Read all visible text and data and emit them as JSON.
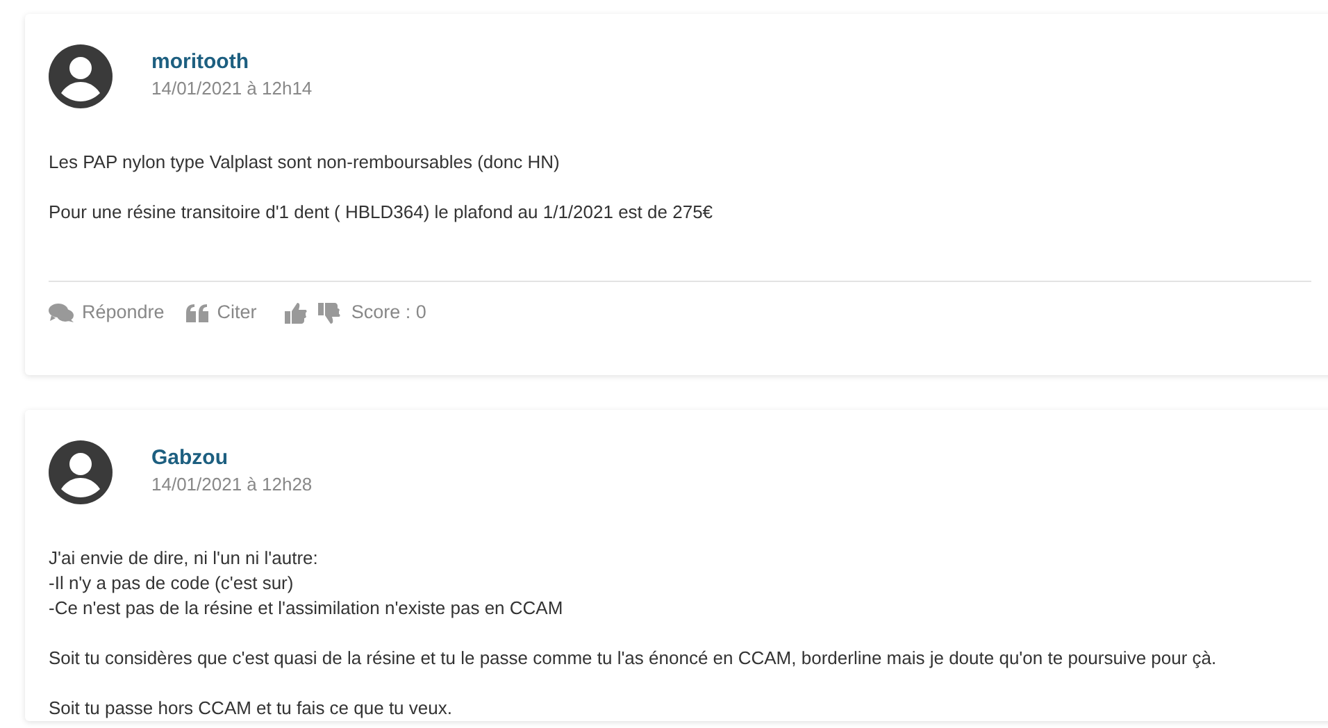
{
  "posts": [
    {
      "author": "moritooth",
      "date": "14/01/2021 à 12h14",
      "paragraphs": [
        [
          "Les PAP nylon type Valplast sont non-remboursables (donc HN)"
        ],
        [
          "Pour une résine transitoire d'1 dent ( HBLD364) le plafond au 1/1/2021 est de 275€"
        ]
      ],
      "actions": {
        "reply": "Répondre",
        "quote": "Citer",
        "score": "Score : 0"
      }
    },
    {
      "author": "Gabzou",
      "date": "14/01/2021 à 12h28",
      "paragraphs": [
        [
          "J'ai envie de dire, ni l'un ni l'autre:",
          "-Il n'y a pas de code (c'est sur)",
          "-Ce n'est pas de la résine et l'assimilation n'existe pas en CCAM"
        ],
        [
          "Soit tu considères que c'est quasi de la résine et tu le passe comme tu l'as énoncé en CCAM, borderline mais je doute qu'on te poursuive pour çà."
        ],
        [
          "Soit tu passe hors CCAM et tu fais ce que tu veux."
        ]
      ]
    }
  ]
}
